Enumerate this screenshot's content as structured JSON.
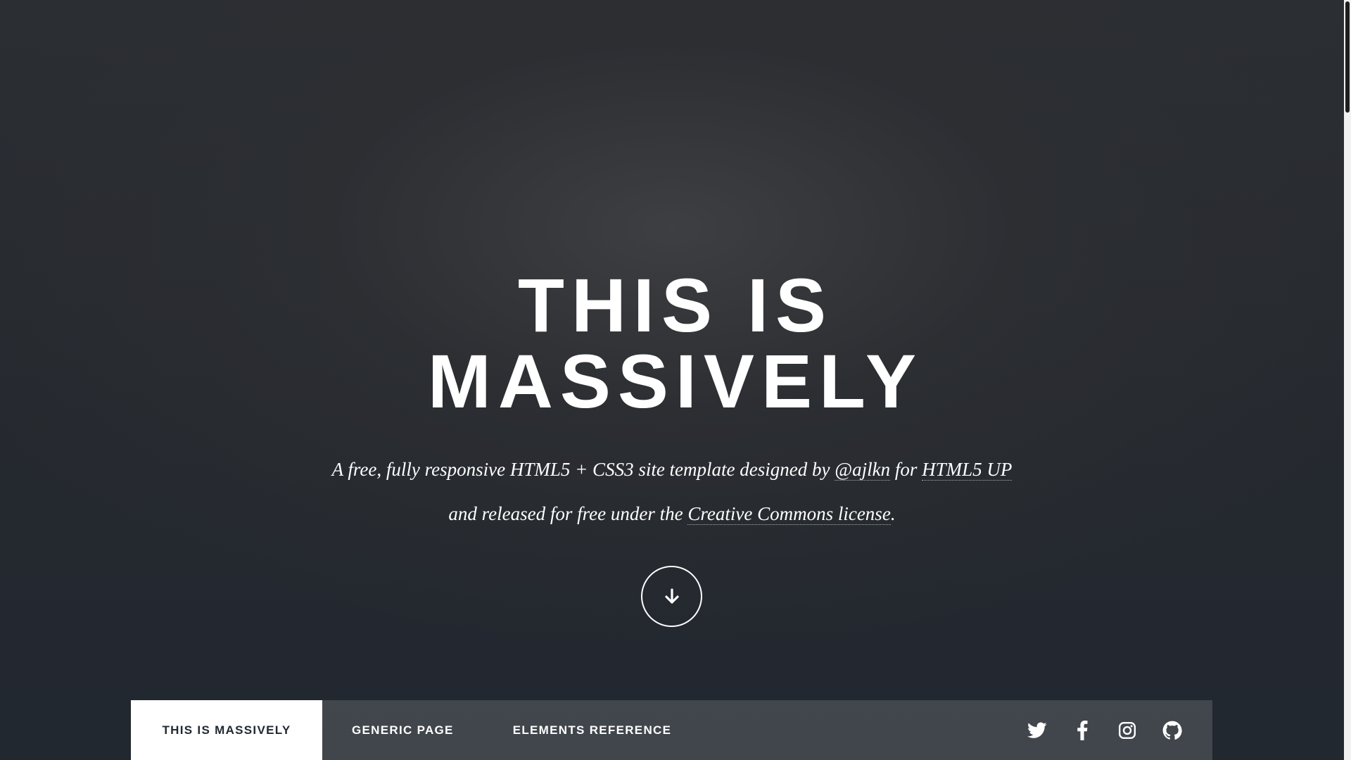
{
  "intro": {
    "title_line1": "THIS IS",
    "title_line2": "MASSIVELY",
    "desc_part1": "A free, fully responsive HTML5 + CSS3 site template designed by ",
    "desc_link1": "@ajlkn",
    "desc_part2": " for ",
    "desc_link2": "HTML5 UP",
    "desc_part3": "and released for free under the ",
    "desc_link3": "Creative Commons license",
    "desc_part4": ".",
    "scroll_icon": "arrow-down-icon"
  },
  "nav": {
    "items": [
      {
        "label": "THIS IS MASSIVELY",
        "active": true
      },
      {
        "label": "GENERIC PAGE",
        "active": false
      },
      {
        "label": "ELEMENTS REFERENCE",
        "active": false
      }
    ],
    "icons": [
      "twitter-icon",
      "facebook-icon",
      "instagram-icon",
      "github-icon"
    ]
  },
  "colors": {
    "background": "#2a2d32",
    "nav_background": "#45484d",
    "active_nav_background": "#ffffff",
    "active_nav_text": "#212931",
    "text": "#ffffff"
  }
}
